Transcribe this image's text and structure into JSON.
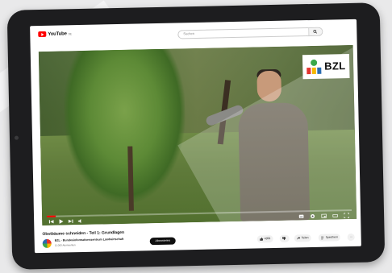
{
  "header": {
    "logo_text": "YouTube",
    "logo_sup": "DE",
    "search_placeholder": "Suchen"
  },
  "video": {
    "watermark": "BZL",
    "progress": 0.03
  },
  "meta": {
    "title": "Obstbäume schneiden - Teil 1: Grundlagen",
    "channel_name": "BZL - Bundesinformationszentrum Landwirtschaft",
    "subscribers": "11.000 Abonnenten",
    "subscribe_label": "Abonnieren",
    "likes": "4356",
    "share_label": "Teilen",
    "save_label": "Speichern",
    "more_label": "···"
  },
  "colors": {
    "accent": "#ff0000",
    "subscribe_bg": "#0f0f0f"
  }
}
